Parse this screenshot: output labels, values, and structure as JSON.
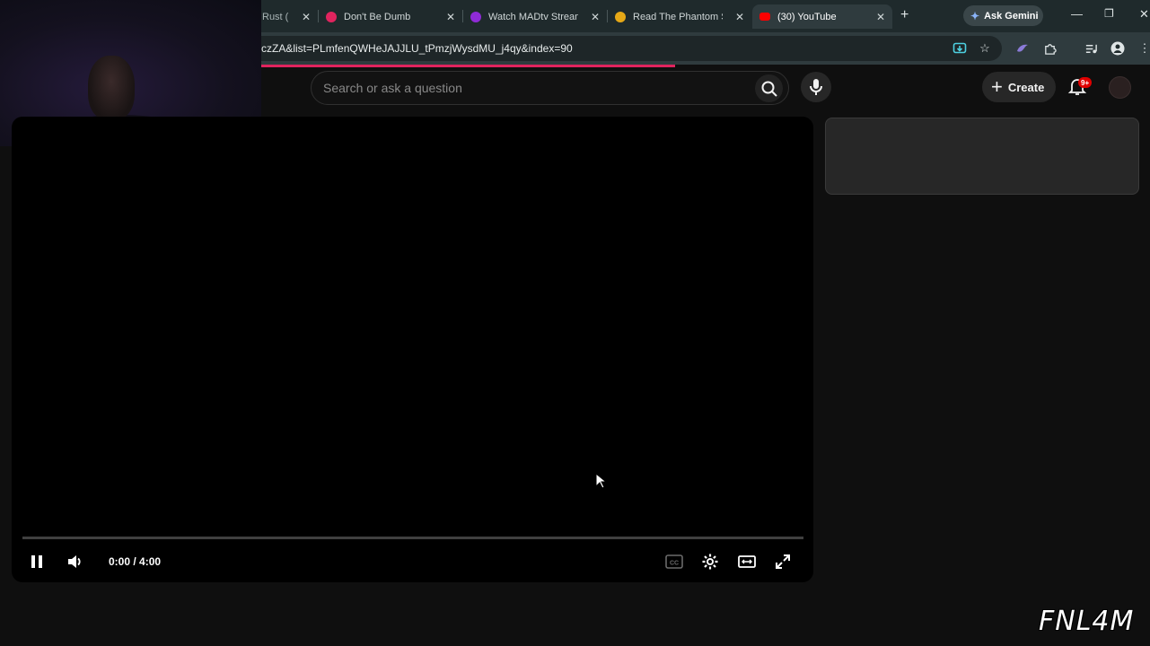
{
  "browser": {
    "tabs": [
      {
        "title": "Rust (",
        "favicon_color": "#9aa6a8"
      },
      {
        "title": "Don't Be Dumb",
        "favicon_color": "#e0245e"
      },
      {
        "title": "Watch MADtv Streami",
        "favicon_color": "#8f2bd6"
      },
      {
        "title": "Read The Phantom Sw",
        "favicon_color": "#e6a817"
      },
      {
        "title": "(30) YouTube",
        "favicon_color": "#ff0000"
      }
    ],
    "close_glyph": "✕",
    "new_tab_glyph": "+",
    "gemini_label": "Ask Gemini",
    "window_controls": {
      "minimize": "—",
      "restore": "❐",
      "close": "✕"
    },
    "url": "czZA&list=PLmfenQWHeJAJJLU_tPmzjWysdMU_j4qy&index=90",
    "page_load_progress": 0.36
  },
  "youtube": {
    "search_placeholder": "Search or ask a question",
    "create_label": "Create",
    "notification_badge": "9+"
  },
  "player": {
    "time_display": "0:00 / 4:00",
    "progress": 0
  },
  "watermark": "FNL4M",
  "colors": {
    "accent": "#e0245e",
    "chrome_frame": "#1f2a2c",
    "yt_background": "#0f0f0f"
  }
}
